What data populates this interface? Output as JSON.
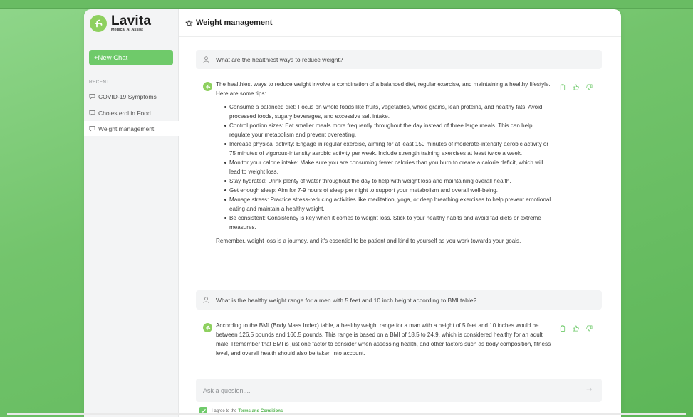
{
  "brand": {
    "name": "Lavita",
    "subtitle": "Medical AI Assist"
  },
  "sidebar": {
    "new_chat_label": "+New Chat",
    "recent_label": "RECENT",
    "items": [
      {
        "label": "COVID-19 Symptoms",
        "active": false
      },
      {
        "label": "Cholesterol in Food",
        "active": false
      },
      {
        "label": "Weight management",
        "active": true
      }
    ]
  },
  "header": {
    "title": "Weight management",
    "icon": "star-icon"
  },
  "conversation": {
    "q1": "What are the healthiest ways to reduce weight?",
    "a1": {
      "intro": "The healthiest ways to reduce weight involve a combination of a balanced diet, regular exercise, and maintaining a healthy lifestyle. Here are some tips:",
      "tips": [
        "Consume a balanced diet: Focus on whole foods like fruits, vegetables, whole grains, lean proteins, and healthy fats. Avoid processed foods, sugary beverages, and excessive salt intake.",
        "Control portion sizes: Eat smaller meals more frequently throughout the day instead of three large meals. This can help regulate your metabolism and prevent overeating.",
        "Increase physical activity: Engage in regular exercise, aiming for at least 150 minutes of moderate-intensity aerobic activity or 75 minutes of vigorous-intensity aerobic activity per week. Include strength training exercises at least twice a week.",
        "Monitor your calorie intake: Make sure you are consuming fewer calories than you burn to create a calorie deficit, which will lead to weight loss.",
        "Stay hydrated: Drink plenty of water throughout the day to help with weight loss and maintaining overall health.",
        "Get enough sleep: Aim for 7-9 hours of sleep per night to support your metabolism and overall well-being.",
        "Manage stress: Practice stress-reducing activities like meditation, yoga, or deep breathing exercises to help prevent emotional eating and maintain a healthy weight.",
        "Be consistent: Consistency is key when it comes to weight loss. Stick to your healthy habits and avoid fad diets or extreme measures."
      ],
      "outro": "Remember, weight loss is a journey, and it's essential to be patient and kind to yourself as you work towards your goals."
    },
    "q2": "What is the healthy weight range for a men with 5 feet and 10 inch height according to BMI table?",
    "a2": {
      "text": "According to the BMI (Body Mass Index) table, a healthy weight range for a man with a height of 5 feet and 10 inches would be between 126.5 pounds and 166.5 pounds. This range is based on a BMI of 18.5 to 24.9, which is considered healthy for an adult male. Remember that BMI is just one factor to consider when assessing health, and other factors such as body composition, fitness level, and overall health should also be taken into account."
    }
  },
  "composer": {
    "placeholder": "Ask a quesion....",
    "agree_text": "I agree to the",
    "terms_link": "Terms and Conditions"
  },
  "colors": {
    "accent": "#6fca6a",
    "brand_logo": "#8ed05f",
    "background_green": "#73c46c"
  }
}
